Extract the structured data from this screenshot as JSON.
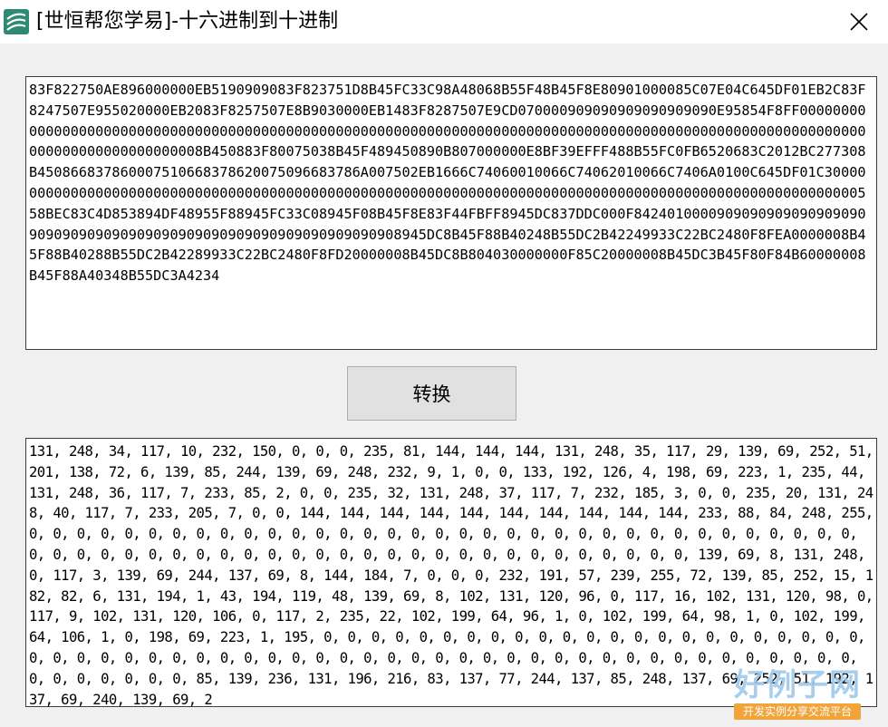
{
  "window": {
    "title": "[世恒帮您学易]-十六进制到十进制",
    "app_icon": "easy-language-icon",
    "close_icon": "close-icon"
  },
  "hex_input": {
    "value": "83F822750AE896000000EB5190909083F823751D8B45FC33C98A48068B55F48B45F8E80901000085C07E04C645DF01EB2C83F8247507E955020000EB2083F8257507E8B9030000EB1483F8287507E9CD070000909090909090909090E95854F8FF0000000000000000000000000000000000000000000000000000000000000000000000000000000000000000000000000000000000000000000000000000000008B450883F80075038B45F489450890B807000000E8BF39EFFF488B55FC0FB6520683C2012BC277308B450866837860007510668378620075096683786A007502EB1666C74060010066C74062010066C7406A0100C645DF01C300000000000000000000000000000000000000000000000000000000000000000000000000000000000000000000000000000000558BEC83C4D853894DF48955F88945FC33C08945F08B45F8E83F44FBFF8945DC837DDC000F8424010000909090909090909090909090909090909090909090909090909090909090908945DC8B45F88B40248B55DC2B42249933C22BC2480F8FEA0000008B45F88B40288B55DC2B42289933C22BC2480F8FD20000008B45DC8B804030000000F85C20000008B45DC3B45F80F84B60000008B45F88A40348B55DC3A4234"
  },
  "convert_button": {
    "label": "转换"
  },
  "dec_output": {
    "value": "131, 248, 34, 117, 10, 232, 150, 0, 0, 0, 235, 81, 144, 144, 144, 131, 248, 35, 117, 29, 139, 69, 252, 51, 201, 138, 72, 6, 139, 85, 244, 139, 69, 248, 232, 9, 1, 0, 0, 133, 192, 126, 4, 198, 69, 223, 1, 235, 44, 131, 248, 36, 117, 7, 233, 85, 2, 0, 0, 235, 32, 131, 248, 37, 117, 7, 232, 185, 3, 0, 0, 235, 20, 131, 248, 40, 117, 7, 233, 205, 7, 0, 0, 144, 144, 144, 144, 144, 144, 144, 144, 144, 144, 233, 88, 84, 248, 255, 0, 0, 0, 0, 0, 0, 0, 0, 0, 0, 0, 0, 0, 0, 0, 0, 0, 0, 0, 0, 0, 0, 0, 0, 0, 0, 0, 0, 0, 0, 0, 0, 0, 0, 0, 0, 0, 0, 0, 0, 0, 0, 0, 0, 0, 0, 0, 0, 0, 0, 0, 0, 0, 0, 0, 0, 0, 0, 0, 0, 0, 0, 0, 139, 69, 8, 131, 248, 0, 117, 3, 139, 69, 244, 137, 69, 8, 144, 184, 7, 0, 0, 0, 232, 191, 57, 239, 255, 72, 139, 85, 252, 15, 182, 82, 6, 131, 194, 1, 43, 194, 119, 48, 139, 69, 8, 102, 131, 120, 96, 0, 117, 16, 102, 131, 120, 98, 0, 117, 9, 102, 131, 120, 106, 0, 117, 2, 235, 22, 102, 199, 64, 96, 1, 0, 102, 199, 64, 98, 1, 0, 102, 199, 64, 106, 1, 0, 198, 69, 223, 1, 195, 0, 0, 0, 0, 0, 0, 0, 0, 0, 0, 0, 0, 0, 0, 0, 0, 0, 0, 0, 0, 0, 0, 0, 0, 0, 0, 0, 0, 0, 0, 0, 0, 0, 0, 0, 0, 0, 0, 0, 0, 0, 0, 0, 0, 0, 0, 0, 0, 0, 0, 0, 0, 0, 0, 0, 0, 0, 0, 0, 0, 0, 0, 0, 0, 0, 85, 139, 236, 131, 196, 216, 83, 137, 77, 244, 137, 85, 248, 137, 69, 252, 51, 192, 137, 69, 240, 139, 69, 2"
  },
  "watermark": {
    "big": "好例子网",
    "small": "开发实例分享交流平台"
  }
}
